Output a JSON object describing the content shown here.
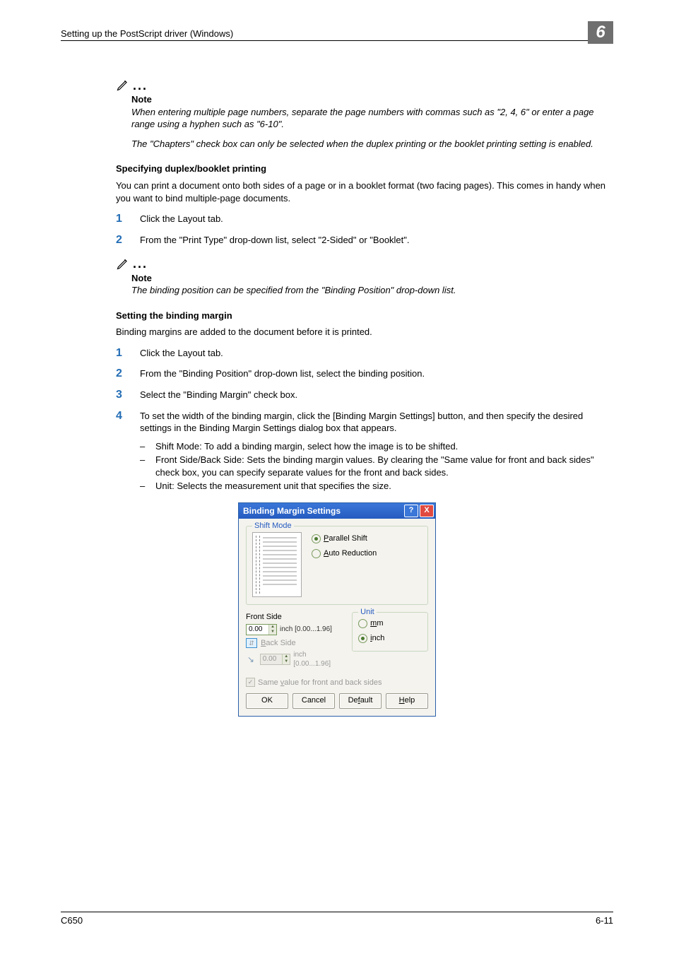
{
  "header": {
    "runningHead": "Setting up the PostScript driver (Windows)",
    "chapterNumber": "6"
  },
  "note1": {
    "label": "Note",
    "p1": "When entering multiple page numbers, separate the page numbers with commas such as \"2, 4, 6\" or enter a page range using a hyphen such as \"6-10\".",
    "p2": "The \"Chapters\" check box can only be selected when the duplex printing or the booklet printing setting is enabled."
  },
  "duplexSection": {
    "heading": "Specifying duplex/booklet printing",
    "intro": "You can print a document onto both sides of a page or in a booklet format (two facing pages). This comes in handy when you want to bind multiple-page documents.",
    "step1": "Click the Layout tab.",
    "step2": "From the \"Print Type\" drop-down list, select \"2-Sided\" or \"Booklet\"."
  },
  "note2": {
    "label": "Note",
    "p1": "The binding position can be specified from the \"Binding Position\" drop-down list."
  },
  "bindingSection": {
    "heading": "Setting the binding margin",
    "intro": "Binding margins are added to the document before it is printed.",
    "step1": "Click the Layout tab.",
    "step2": "From the \"Binding Position\" drop-down list, select the binding position.",
    "step3": "Select the \"Binding Margin\" check box.",
    "step4": "To set the width of the binding margin, click the [Binding Margin Settings] button, and then specify the desired settings in the Binding Margin Settings dialog box that appears.",
    "bullet_shift": "Shift Mode: To add a binding margin, select how the image is to be shifted.",
    "bullet_sides": "Front Side/Back Side: Sets the binding margin values. By clearing the \"Same value for front and back sides\" check box, you can specify separate values for the front and back sides.",
    "bullet_unit": "Unit: Selects the measurement unit that specifies the size."
  },
  "dialog": {
    "title": "Binding Margin Settings",
    "groupShift": "Shift Mode",
    "optParallel_pre": "P",
    "optParallel_post": "arallel Shift",
    "optAuto_pre": "A",
    "optAuto_post": "uto Reduction",
    "lblFront": "Front Side",
    "lblBack_pre": "B",
    "lblBack_post": "ack Side",
    "frontVal": "0.00",
    "backVal": "0.00",
    "rangeHint": "inch [0.00...1.96]",
    "groupUnit": "Unit",
    "optMm_pre": "m",
    "optMm_post": "m",
    "optInch_pre": "i",
    "optInch_post": "nch",
    "sameValue_pre": "Same ",
    "sameValue_mid": "v",
    "sameValue_post": "alue for front and back sides",
    "btnOK": "OK",
    "btnCancel": "Cancel",
    "btnDefault_pre": "De",
    "btnDefault_mid": "f",
    "btnDefault_post": "ault",
    "btnHelp_pre": "H",
    "btnHelp_post": "elp"
  },
  "footer": {
    "model": "C650",
    "pageNumber": "6-11"
  }
}
